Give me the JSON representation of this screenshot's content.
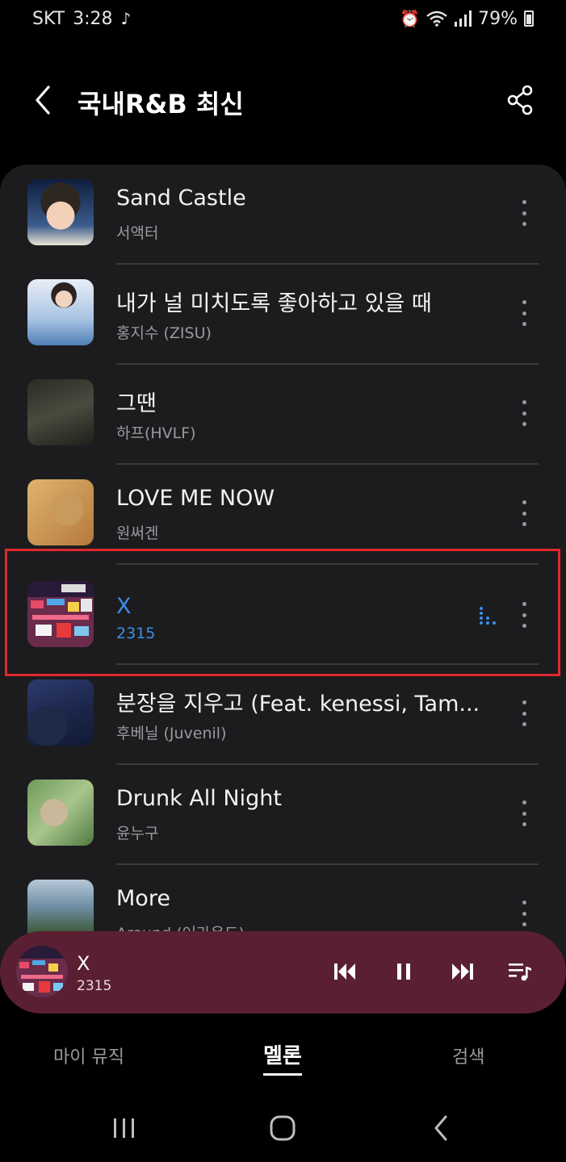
{
  "status_bar": {
    "carrier": "SKT",
    "time": "3:28",
    "battery": "79%"
  },
  "header": {
    "title": "국내R&B 최신"
  },
  "tracks": [
    {
      "title": "Sand Castle",
      "artist": "서액터",
      "active": false
    },
    {
      "title": "내가 널 미치도록 좋아하고 있을 때",
      "artist": "홍지수 (ZISU)",
      "active": false
    },
    {
      "title": "그땐",
      "artist": "하프(HVLF)",
      "active": false
    },
    {
      "title": "LOVE ME NOW",
      "artist": "원써겐",
      "active": false
    },
    {
      "title": "X",
      "artist": "2315",
      "active": true
    },
    {
      "title": "분장을 지우고 (Feat. kenessi, Tam...",
      "artist": "후베닐 (Juvenil)",
      "active": false
    },
    {
      "title": "Drunk All Night",
      "artist": "윤누구",
      "active": false
    },
    {
      "title": "More",
      "artist": "Around (어라운드)",
      "active": false
    }
  ],
  "mini_player": {
    "title": "X",
    "artist": "2315"
  },
  "bottom_tabs": {
    "my_music": "마이 뮤직",
    "melon": "멜론",
    "search": "검색"
  },
  "colors": {
    "accent": "#3b8fe6",
    "mini_player_bg": "#5a1f32",
    "highlight": "#e0282e"
  }
}
